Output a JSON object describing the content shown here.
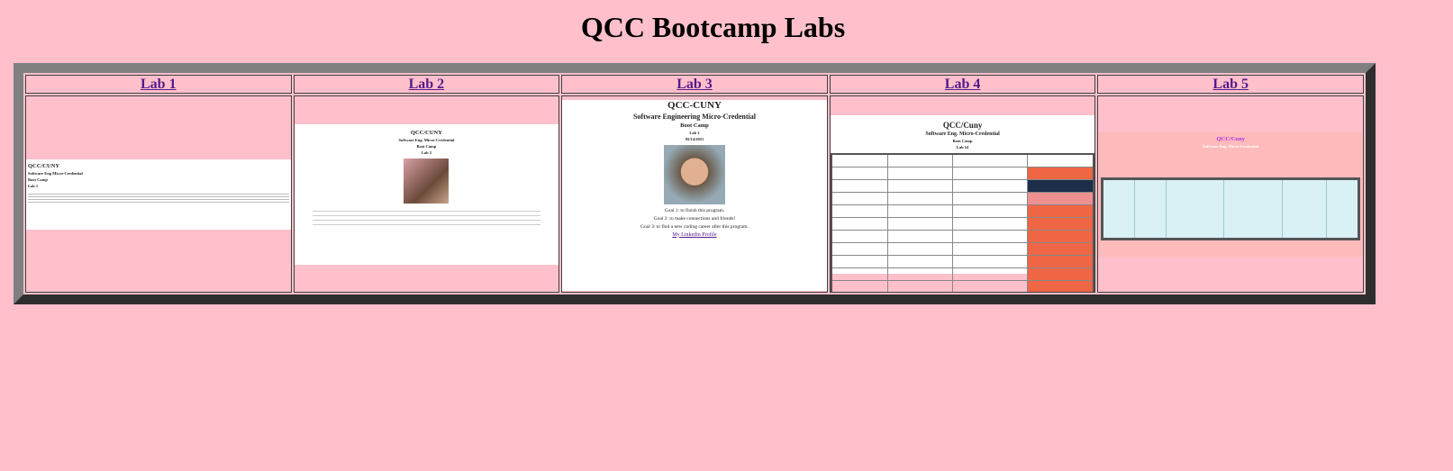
{
  "page": {
    "title": "QCC Bootcamp Labs"
  },
  "labs": [
    {
      "label": "Lab 1"
    },
    {
      "label": "Lab 2"
    },
    {
      "label": "Lab 3"
    },
    {
      "label": "Lab 4"
    },
    {
      "label": "Lab 5"
    }
  ],
  "thumbnails": {
    "lab1": {
      "school": "QCC/CUNY",
      "program": "Software Eng Micro-Credential",
      "course": "Boot Camp",
      "lab": "Lab 1"
    },
    "lab2": {
      "school": "QCC/CUNY",
      "program": "Software Eng. Micro-Credential",
      "course": "Boot Camp",
      "lab": "Lab 2"
    },
    "lab3": {
      "school": "QCC-CUNY",
      "program": "Software Engineering Micro-Credential",
      "course": "Boot Camp",
      "lab": "Lab 3",
      "date": "05/14/2021",
      "goal1": "Goal 1: to finish this program.",
      "goal2": "Goal 2: to make connections and friends!",
      "goal3": "Goal 3: to find a new coding career after this program.",
      "link": "My Linkedin Profile"
    },
    "lab4": {
      "school": "QCC/Cuny",
      "program": "Software Eng. Micro-Credential",
      "course": "Boot Camp",
      "lab": "Lab #4"
    },
    "lab5": {
      "school": "QCC/Cuny",
      "program": "Software Eng. Micro-Credential"
    }
  }
}
